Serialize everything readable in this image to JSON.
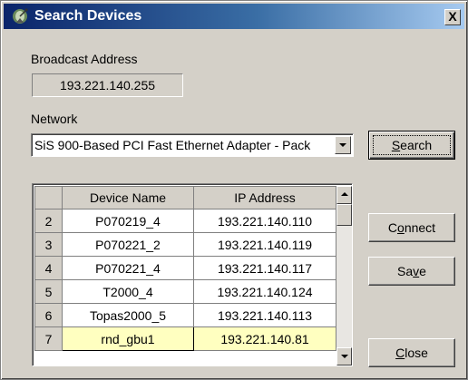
{
  "window": {
    "title": "Search Devices",
    "close_glyph": "X",
    "icon": "satellite-dish-icon"
  },
  "broadcast": {
    "label": "Broadcast Address",
    "value": "193.221.140.255"
  },
  "network": {
    "label": "Network",
    "selected": "SiS 900-Based PCI Fast Ethernet Adapter - Pack"
  },
  "buttons": {
    "search": {
      "mnemonic": "S",
      "rest": "earch"
    },
    "connect": {
      "pre": "C",
      "mnemonic": "o",
      "rest": "nnect"
    },
    "save": {
      "pre": "Sa",
      "mnemonic": "v",
      "rest": "e"
    },
    "close": {
      "mnemonic": "C",
      "rest": "lose"
    }
  },
  "table": {
    "columns": [
      "Device Name",
      "IP Address"
    ],
    "rows": [
      {
        "num": "2",
        "name": "P070219_4",
        "ip": "193.221.140.110"
      },
      {
        "num": "3",
        "name": "P070221_2",
        "ip": "193.221.140.119"
      },
      {
        "num": "4",
        "name": "P070221_4",
        "ip": "193.221.140.117"
      },
      {
        "num": "5",
        "name": "T2000_4",
        "ip": "193.221.140.124"
      },
      {
        "num": "6",
        "name": "Topas2000_5",
        "ip": "193.221.140.113"
      },
      {
        "num": "7",
        "name": "rnd_gbu1",
        "ip": "193.221.140.81",
        "selected": true
      }
    ]
  },
  "colors": {
    "title_gradient_start": "#0a246a",
    "title_gradient_end": "#a6caf0",
    "face": "#d4d0c8",
    "selected_row": "#ffffc0"
  }
}
